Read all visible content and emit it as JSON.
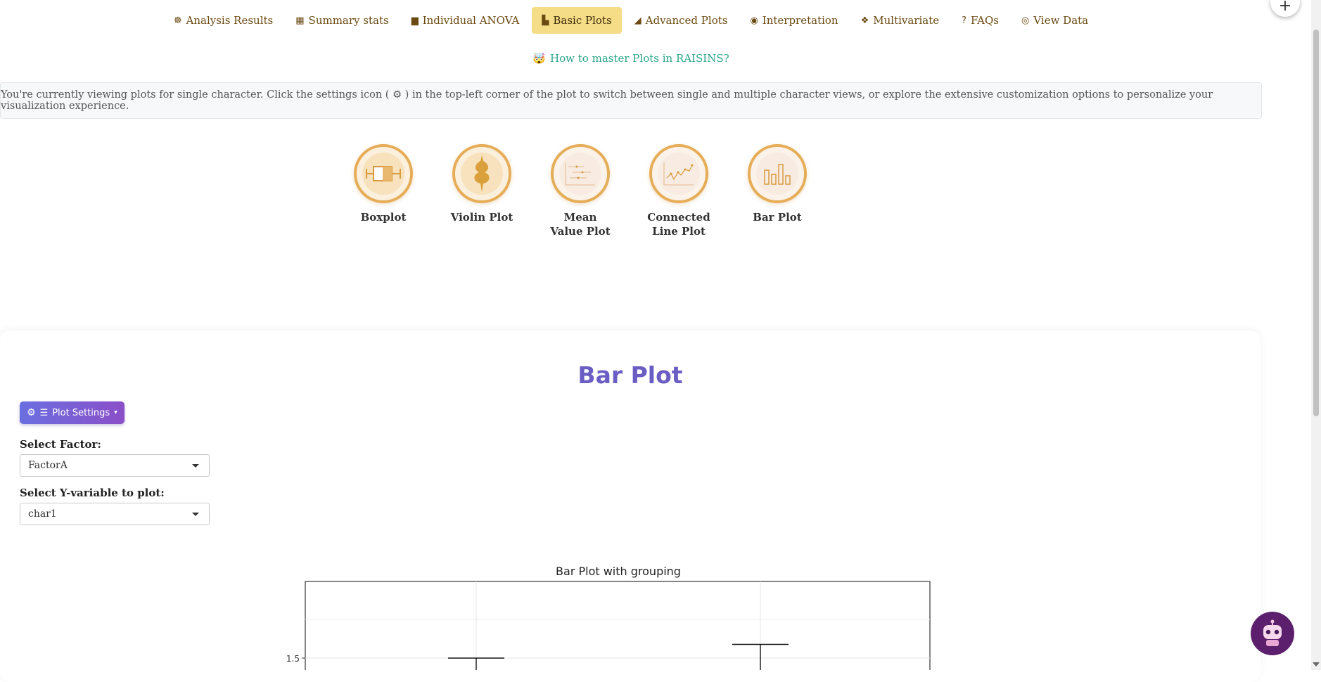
{
  "nav": {
    "tabs": [
      {
        "label": "Analysis Results",
        "icon": "brain-icon",
        "glyph": "☸"
      },
      {
        "label": "Summary stats",
        "icon": "table-icon",
        "glyph": "▦"
      },
      {
        "label": "Individual ANOVA",
        "icon": "calendar-icon",
        "glyph": "▆"
      },
      {
        "label": "Basic Plots",
        "icon": "chart-bar-icon",
        "glyph": "▙",
        "active": true
      },
      {
        "label": "Advanced Plots",
        "icon": "chart-area-icon",
        "glyph": "◢"
      },
      {
        "label": "Interpretation",
        "icon": "compass-icon",
        "glyph": "◉"
      },
      {
        "label": "Multivariate",
        "icon": "cubes-icon",
        "glyph": "❖"
      },
      {
        "label": "FAQs",
        "icon": "question-icon",
        "glyph": "?"
      },
      {
        "label": "View Data",
        "icon": "eye-icon",
        "glyph": "◎"
      }
    ]
  },
  "help_link": {
    "label": "How to master Plots in RAISINS?",
    "icon": "emoji-icon"
  },
  "banner": {
    "text": "You're currently viewing plots for single character. Click the settings icon ( ⚙ ) in the top-left corner of the plot to switch between single and multiple character views, or explore the extensive customization options to personalize your visualization experience."
  },
  "plot_types": [
    {
      "label": "Boxplot",
      "icon": "boxplot-icon"
    },
    {
      "label": "Violin Plot",
      "icon": "violin-plot-icon"
    },
    {
      "label": "Mean Value Plot",
      "icon": "mean-value-plot-icon"
    },
    {
      "label": "Connected Line Plot",
      "icon": "connected-line-plot-icon"
    },
    {
      "label": "Bar Plot",
      "icon": "bar-plot-icon"
    }
  ],
  "card": {
    "title": "Bar Plot",
    "settings_button": "Plot Settings",
    "factor_label": "Select Factor:",
    "factor_value": "FactorA",
    "yvar_label": "Select Y-variable to plot:",
    "yvar_value": "char1"
  },
  "chart_data": {
    "type": "bar",
    "title": "Bar Plot with grouping",
    "xlabel": "",
    "ylabel": "",
    "ytick_labels": [
      "1.5"
    ],
    "categories": [
      "",
      ""
    ],
    "error_bar_upper": [
      1.5,
      1.53
    ],
    "grid": true
  },
  "colors": {
    "accent": "#6a5ec4",
    "active_tab": "#f5dc86",
    "tab_text": "#6b4a12",
    "help_link": "#2aa58a",
    "plot_icon_border": "#e6ad58"
  }
}
